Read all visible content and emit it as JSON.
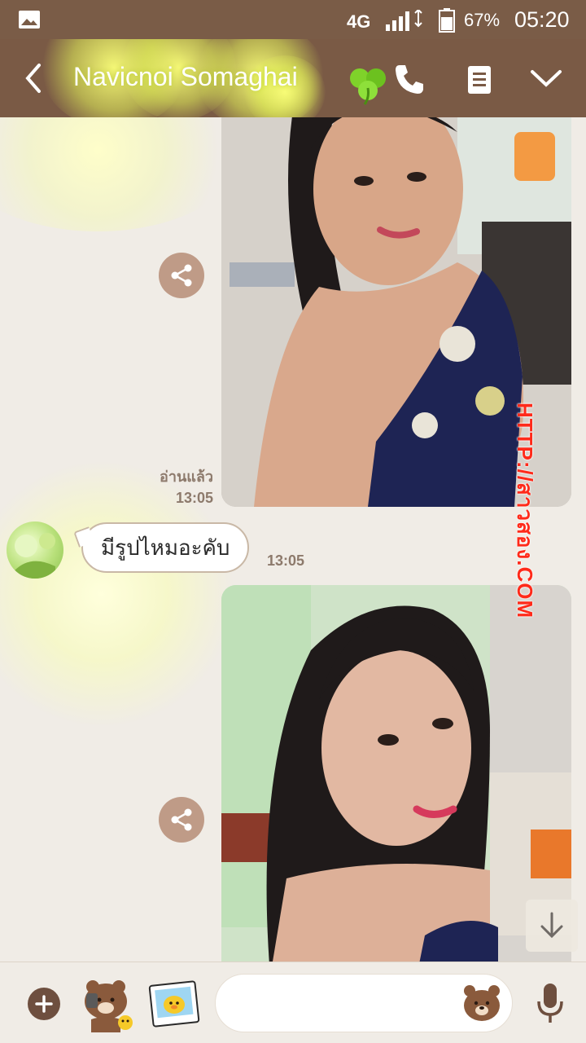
{
  "status_bar": {
    "network": "4G",
    "battery": "67%",
    "time": "05:20"
  },
  "header": {
    "contact_name": "Navicnoi Somaghai"
  },
  "messages": {
    "outgoing_photo_1": {
      "read_label": "อ่านแล้ว",
      "time": "13:05"
    },
    "incoming_text": {
      "text": "มีรูปไหมอะคับ",
      "time": "13:05"
    }
  },
  "watermark": "HTTP://สาวสอง.COM",
  "colors": {
    "header_bg": "#7a5a45",
    "chat_bg": "#f0ece6",
    "share_button": "#bf9b87",
    "watermark": "#ff2a1a"
  },
  "icons": {
    "back": "chevron-left-icon",
    "call": "phone-icon",
    "notes": "notes-icon",
    "menu": "chevron-down-icon",
    "share": "share-icon",
    "add": "plus-icon",
    "voice": "microphone-icon",
    "scroll_down": "arrow-down-icon"
  }
}
